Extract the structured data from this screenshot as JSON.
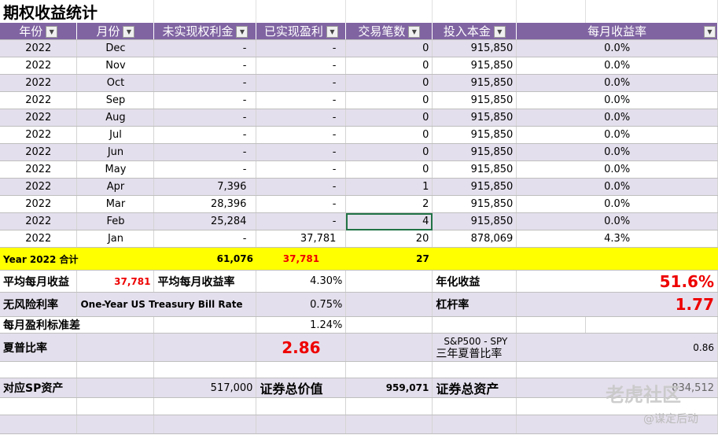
{
  "title": "期权收益统计",
  "headers": [
    "年份",
    "月份",
    "未实现权利金",
    "已实现盈利",
    "交易笔数",
    "投入本金",
    "每月收益率"
  ],
  "rows": [
    [
      "2022",
      "Dec",
      "-",
      "-",
      "0",
      "915,850",
      "0.0%"
    ],
    [
      "2022",
      "Nov",
      "-",
      "-",
      "0",
      "915,850",
      "0.0%"
    ],
    [
      "2022",
      "Oct",
      "-",
      "-",
      "0",
      "915,850",
      "0.0%"
    ],
    [
      "2022",
      "Sep",
      "-",
      "-",
      "0",
      "915,850",
      "0.0%"
    ],
    [
      "2022",
      "Aug",
      "-",
      "-",
      "0",
      "915,850",
      "0.0%"
    ],
    [
      "2022",
      "Jul",
      "-",
      "-",
      "0",
      "915,850",
      "0.0%"
    ],
    [
      "2022",
      "Jun",
      "-",
      "-",
      "0",
      "915,850",
      "0.0%"
    ],
    [
      "2022",
      "May",
      "-",
      "-",
      "0",
      "915,850",
      "0.0%"
    ],
    [
      "2022",
      "Apr",
      "7,396",
      "-",
      "1",
      "915,850",
      "0.0%"
    ],
    [
      "2022",
      "Mar",
      "28,396",
      "-",
      "2",
      "915,850",
      "0.0%"
    ],
    [
      "2022",
      "Feb",
      "25,284",
      "-",
      "4",
      "915,850",
      "0.0%"
    ],
    [
      "2022",
      "Jan",
      "-",
      "37,781",
      "20",
      "878,069",
      "4.3%"
    ]
  ],
  "total": {
    "label": "Year 2022 合计",
    "unrealized": "61,076",
    "realized": "37,781",
    "trades": "27"
  },
  "stats": {
    "avg_monthly_label": "平均每月收益",
    "avg_monthly": "37,781",
    "avg_rate_label": "平均每月收益率",
    "avg_rate": "4.30%",
    "annual_label": "年化收益",
    "annual": "51.6%",
    "riskfree_label": "无风险利率",
    "riskfree_desc": "One-Year US Treasury Bill Rate",
    "riskfree": "0.75%",
    "leverage_label": "杠杆率",
    "leverage": "1.77",
    "std_label": "每月盈利标准差",
    "std": "1.24%",
    "sharpe_label": "夏普比率",
    "sharpe": "2.86",
    "spy_label1": "S&P500 - SPY",
    "spy_label2": "三年夏普比率",
    "spy_sharpe": "0.86",
    "sp_asset_label": "对应SP资产",
    "sp_asset": "517,000",
    "sec_value_label": "证券总价值",
    "sec_value": "959,071",
    "sec_total_label": "证券总资产",
    "sec_total": "834,512"
  },
  "watermark": {
    "brand": "老虎社区",
    "user": "@谋定后动"
  }
}
